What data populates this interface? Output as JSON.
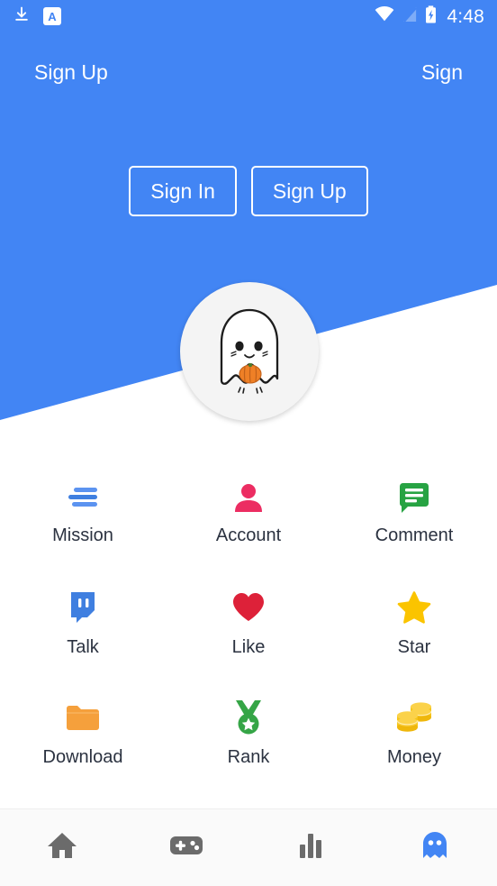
{
  "status_bar": {
    "icons_left": [
      "download-icon",
      "translate-app-icon"
    ],
    "app_badge_letter": "A",
    "icons_right": [
      "wifi-icon",
      "cellular-signal-icon",
      "battery-charging-icon"
    ],
    "time": "4:48"
  },
  "header": {
    "left_link": "Sign Up",
    "right_link": "Sign",
    "background_color": "#4285f4",
    "buttons": [
      {
        "label": "Sign In",
        "name": "sign-in-button"
      },
      {
        "label": "Sign Up",
        "name": "sign-up-button"
      }
    ]
  },
  "avatar": {
    "name": "user-avatar",
    "icon": "ghost-with-pumpkin-icon"
  },
  "grid": {
    "items": [
      {
        "label": "Mission",
        "icon": "list-lines-icon",
        "color": "#4285f4"
      },
      {
        "label": "Account",
        "icon": "person-icon",
        "color": "#ec2d62"
      },
      {
        "label": "Comment",
        "icon": "speech-bubble-icon",
        "color": "#27a343"
      },
      {
        "label": "Talk",
        "icon": "twitch-chat-icon",
        "color": "#3f7fe0"
      },
      {
        "label": "Like",
        "icon": "heart-icon",
        "color": "#dd2139"
      },
      {
        "label": "Star",
        "icon": "star-icon",
        "color": "#fbc400"
      },
      {
        "label": "Download",
        "icon": "folder-icon",
        "color": "#f5a03c"
      },
      {
        "label": "Rank",
        "icon": "medal-icon",
        "color": "#35a546"
      },
      {
        "label": "Money",
        "icon": "coins-icon",
        "color": "#f5c518"
      }
    ]
  },
  "bottom_nav": {
    "items": [
      {
        "icon": "home-icon",
        "name": "nav-home",
        "active": false
      },
      {
        "icon": "gamepad-icon",
        "name": "nav-games",
        "active": false
      },
      {
        "icon": "bar-chart-icon",
        "name": "nav-stats",
        "active": false
      },
      {
        "icon": "ghost-icon",
        "name": "nav-profile",
        "active": true
      }
    ],
    "inactive_color": "#6b6b6b",
    "active_color": "#4285f4"
  }
}
